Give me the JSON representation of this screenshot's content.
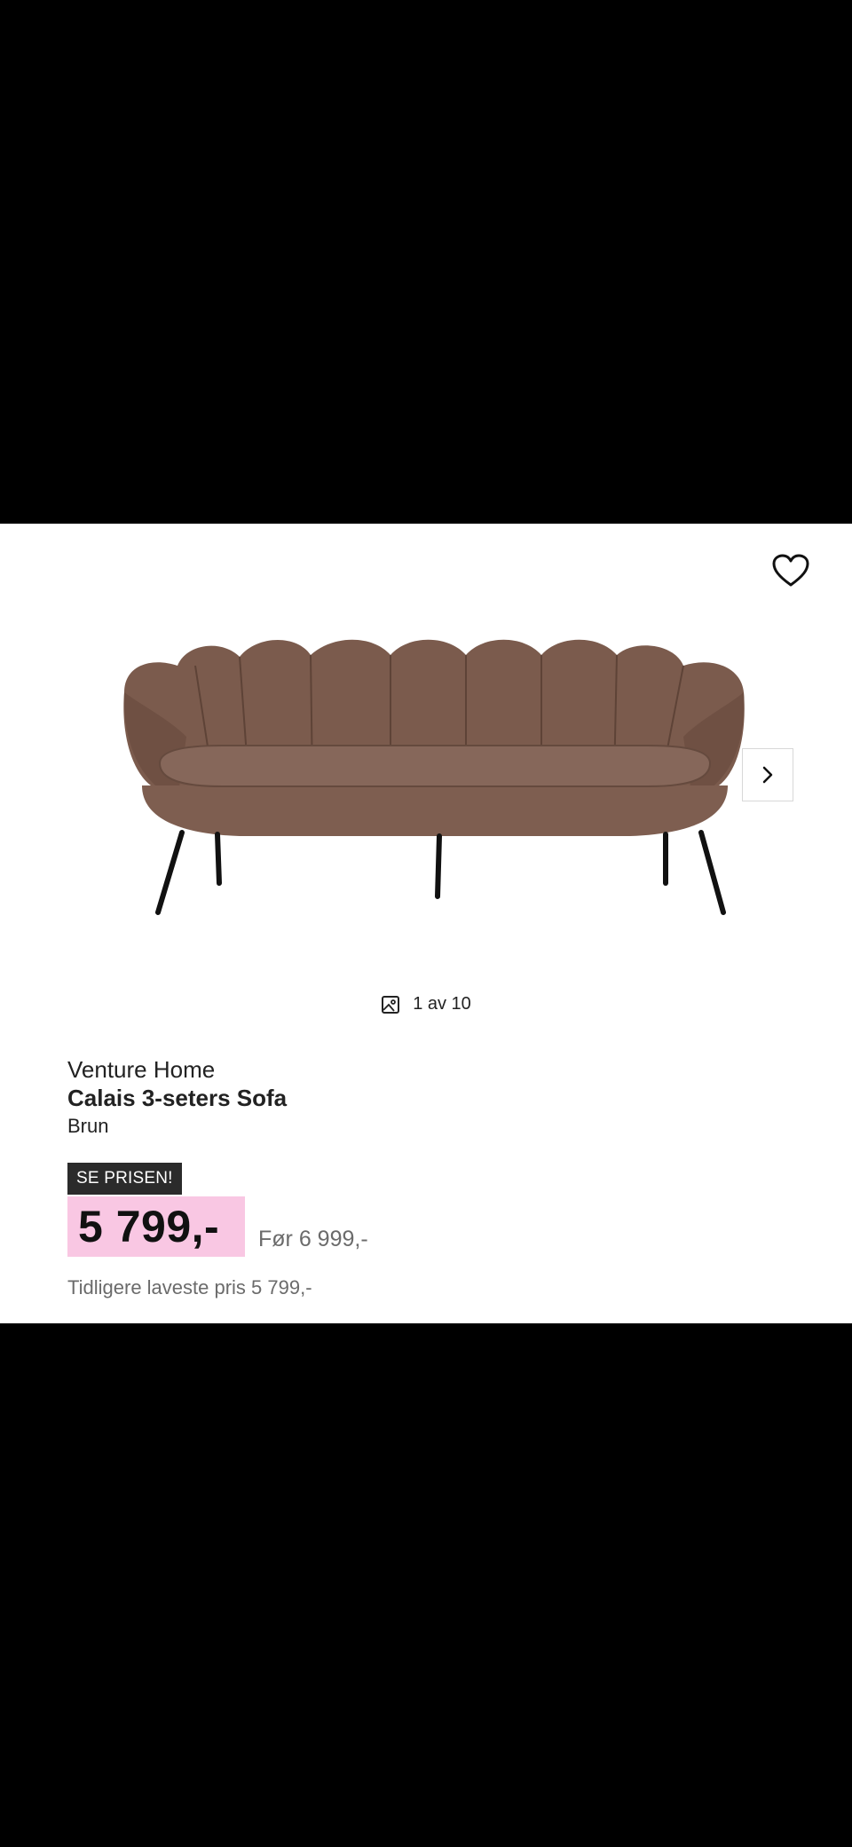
{
  "product": {
    "brand": "Venture Home",
    "name": "Calais 3-seters Sofa",
    "variant": "Brun",
    "badge": "SE PRISEN!",
    "price": "5 799,-",
    "before_price": "Før 6 999,-",
    "lowest_price_note": "Tidligere laveste pris 5 799,-"
  },
  "gallery": {
    "counter": "1 av 10",
    "current": 1,
    "total": 10
  },
  "icons": {
    "favorite": "heart-icon",
    "next": "chevron-right-icon",
    "gallery": "image-icon"
  },
  "colors": {
    "price_highlight": "#f9c7e3",
    "badge_bg": "#2b2b2b",
    "sofa": "#7a5a4c"
  }
}
